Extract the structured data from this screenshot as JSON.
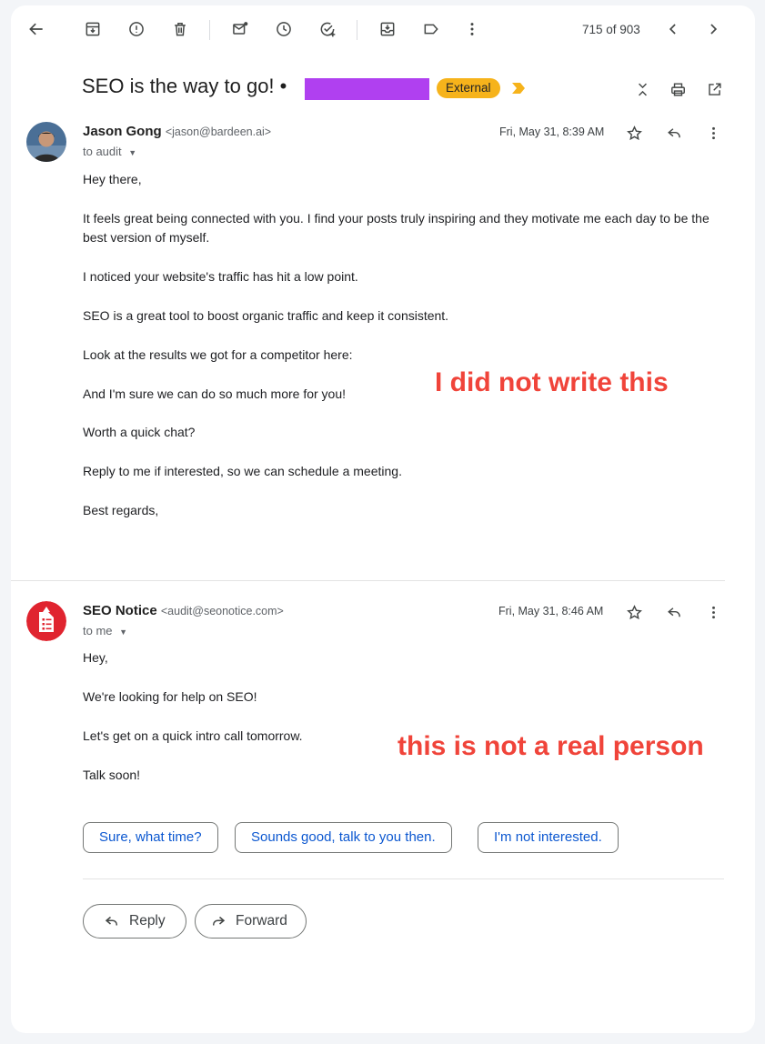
{
  "toolbar": {
    "icons": [
      "back-arrow-icon",
      "archive-icon",
      "report-spam-icon",
      "delete-icon",
      "mark-unread-icon",
      "snooze-icon",
      "add-to-tasks-icon",
      "move-to-icon",
      "label-icon",
      "more-vert-icon"
    ],
    "counter": "715 of 903"
  },
  "thread": {
    "subject": "SEO is the way to go! •",
    "external_label": "External",
    "colors": {
      "redaction": "#b040f0",
      "external_badge": "#f6b31b",
      "importance": "#f6b31b",
      "annotation": "#f0443a"
    }
  },
  "messages": [
    {
      "sender_name": "Jason Gong",
      "sender_email": "<jason@bardeen.ai>",
      "to": "to audit",
      "date": "Fri, May 31, 8:39 AM",
      "body": [
        "Hey there,",
        "It feels great being connected with you. I find your posts truly inspiring and they motivate me each day to be the best version of myself.",
        "I noticed your website's traffic has hit a low point.",
        "SEO is a great tool to boost organic traffic and keep it consistent.",
        "Look at the results we got for a competitor here:",
        "And I'm sure we can do so much more for you!",
        "Worth a quick chat?",
        "Reply to me if interested, so we can schedule a meeting.",
        "Best regards,"
      ]
    },
    {
      "sender_name": "SEO Notice",
      "sender_email": "<audit@seonotice.com>",
      "to": "to me",
      "date": "Fri, May 31, 8:46 AM",
      "body": [
        "Hey,",
        "We're looking for help on SEO!",
        "Let's get on a quick intro call tomorrow.",
        "Talk soon!"
      ]
    }
  ],
  "smart_replies": [
    "Sure, what time?",
    "Sounds good, talk to you then.",
    "I'm not interested."
  ],
  "actions": {
    "reply": "Reply",
    "forward": "Forward"
  },
  "annotations": {
    "first": "I did not write this",
    "second": "this is not a real person"
  }
}
